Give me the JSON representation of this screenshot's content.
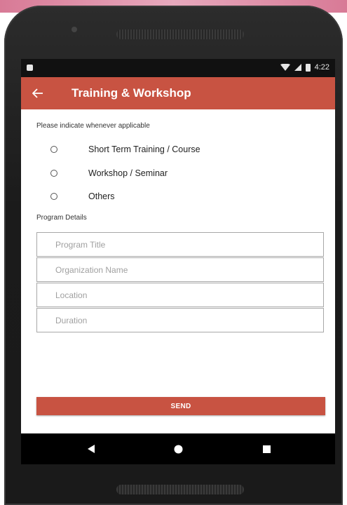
{
  "status_bar": {
    "time": "4:22",
    "icons": [
      "notification-icon",
      "wifi-icon",
      "signal-icon",
      "battery-icon"
    ]
  },
  "app_bar": {
    "title": "Training & Workshop",
    "back_icon": "arrow-left-icon",
    "color": "#c85342"
  },
  "form": {
    "hint": "Please indicate whenever applicable",
    "options": [
      {
        "label": "Short Term Training / Course",
        "selected": false
      },
      {
        "label": "Workshop / Seminar",
        "selected": false
      },
      {
        "label": "Others",
        "selected": false
      }
    ],
    "details_label": "Program Details",
    "fields": [
      {
        "placeholder": "Program Title",
        "value": ""
      },
      {
        "placeholder": "Organization Name",
        "value": ""
      },
      {
        "placeholder": "Location",
        "value": ""
      },
      {
        "placeholder": "Duration",
        "value": ""
      }
    ],
    "send_label": "SEND"
  },
  "nav_bar": {
    "buttons": [
      "back-triangle-icon",
      "home-circle-icon",
      "recents-square-icon"
    ]
  }
}
